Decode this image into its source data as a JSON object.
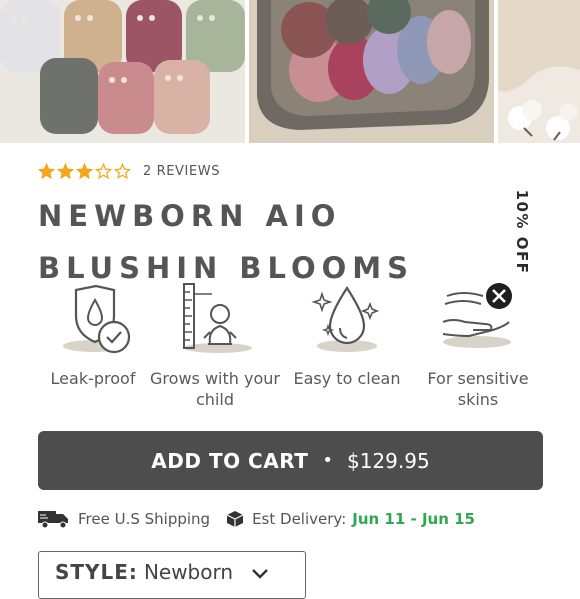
{
  "gallery": {
    "images": [
      {
        "name": "diaper-collection-photo"
      },
      {
        "name": "diapers-in-basket-photo"
      },
      {
        "name": "cotton-fabric-photo"
      }
    ]
  },
  "product": {
    "rating": 3,
    "rating_max": 5,
    "reviews_label": "2 REVIEWS",
    "title": "NEWBORN AIO BLUSHIN BLOOMS",
    "discount_badge": "10% OFF"
  },
  "features": [
    {
      "icon": "leak-proof-icon",
      "label": "Leak-proof"
    },
    {
      "icon": "growth-chart-icon",
      "label": "Grows with your child"
    },
    {
      "icon": "water-drop-icon",
      "label": "Easy to clean"
    },
    {
      "icon": "sensitive-skin-icon",
      "label": "For sensitive skins"
    }
  ],
  "cart": {
    "label": "ADD TO CART",
    "separator": "•",
    "price": "$129.95"
  },
  "shipping": {
    "free_label": "Free U.S Shipping",
    "delivery_label": "Est Delivery:",
    "delivery_dates": "Jun 11 - Jun 15"
  },
  "style_select": {
    "label": "STYLE:",
    "value": "Newborn"
  },
  "colors": {
    "star": "#f2a71b",
    "button": "#4d4d4d",
    "delivery_green": "#2fa84f",
    "text": "#555555"
  }
}
